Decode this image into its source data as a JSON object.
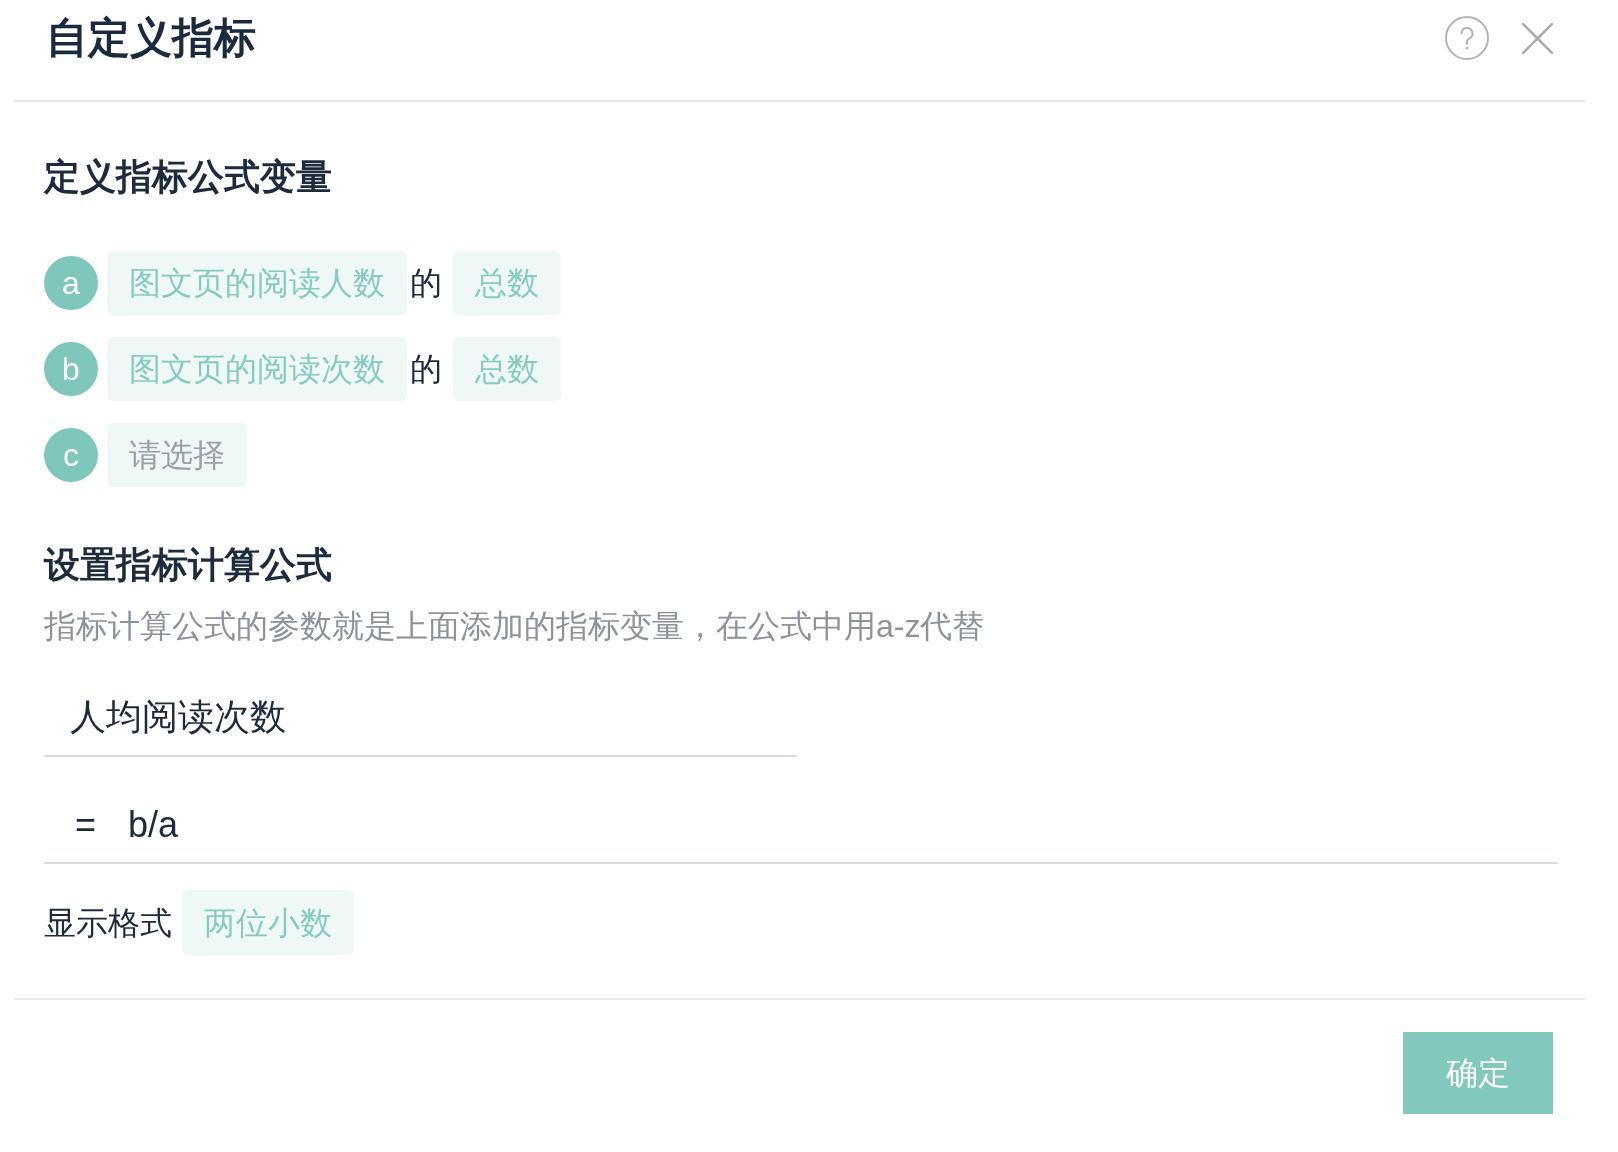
{
  "dialog": {
    "title": "自定义指标"
  },
  "variables_section": {
    "title": "定义指标公式变量",
    "variables": [
      {
        "letter": "a",
        "kind": "filled",
        "metric": "图文页的阅读人数",
        "connector": "的",
        "aggregation": "总数"
      },
      {
        "letter": "b",
        "kind": "filled",
        "metric": "图文页的阅读次数",
        "connector": "的",
        "aggregation": "总数"
      },
      {
        "letter": "c",
        "kind": "empty",
        "placeholder": "请选择"
      }
    ]
  },
  "formula_section": {
    "title": "设置指标计算公式",
    "hint": "指标计算公式的参数就是上面添加的指标变量，在公式中用a-z代替",
    "name_field": {
      "value": "人均阅读次数"
    },
    "formula_field": {
      "operator": "=",
      "value": "b/a"
    }
  },
  "display_format": {
    "label": "显示格式",
    "value": "两位小数"
  },
  "footer": {
    "confirm_button": "确定"
  }
}
